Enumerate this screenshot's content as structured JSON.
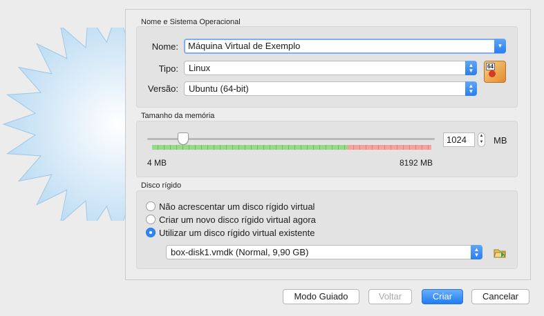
{
  "sections": {
    "name_os": {
      "title": "Nome e Sistema Operacional",
      "name_label": "Nome:",
      "name_value": "Máquina Virtual de Exemplo",
      "type_label": "Tipo:",
      "type_value": "Linux",
      "version_label": "Versão:",
      "version_value": "Ubuntu (64-bit)",
      "os_icon_badge": "64"
    },
    "memory": {
      "title": "Tamanho da memória",
      "value": "1024",
      "unit": "MB",
      "min_label": "4 MB",
      "max_label": "8192 MB",
      "slider_fraction": 0.125
    },
    "disk": {
      "title": "Disco rígido",
      "options": [
        "Não acrescentar um disco rígido virtual",
        "Criar um novo disco rígido virtual agora",
        "Utilizar um disco rígido virtual existente"
      ],
      "selected_index": 2,
      "existing_disk": "box-disk1.vmdk (Normal, 9,90 GB)"
    }
  },
  "buttons": {
    "guided": "Modo Guiado",
    "back": "Voltar",
    "create": "Criar",
    "cancel": "Cancelar"
  },
  "colors": {
    "accent": "#2a7ef0",
    "scale_green": "#9ad88a",
    "scale_red": "#f2a3a0"
  }
}
